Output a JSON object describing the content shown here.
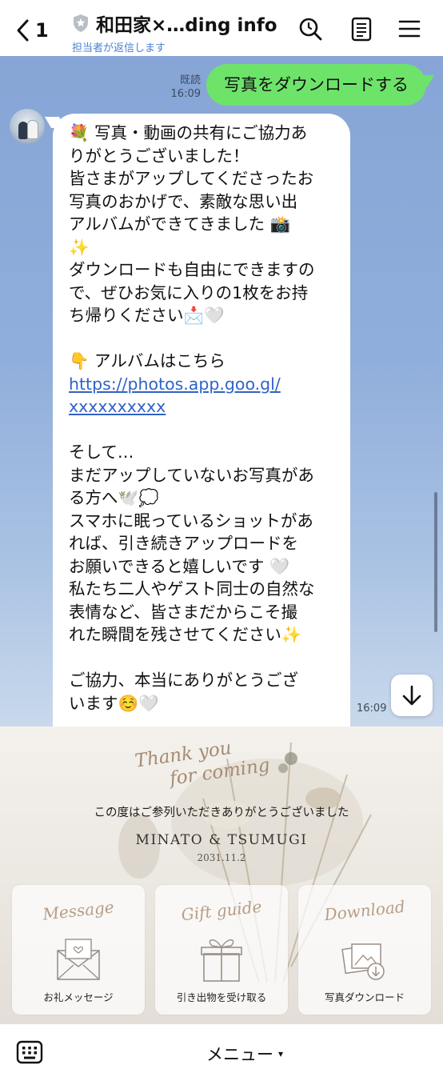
{
  "header": {
    "unread_count": "1",
    "title": "和田家×…ding info",
    "subtitle": "担当者が返信します",
    "icons": [
      "back-chevron-icon",
      "shield-icon",
      "search-icon",
      "notes-icon",
      "menu-icon"
    ]
  },
  "chat": {
    "sent": {
      "read_label": "既読",
      "time": "16:09",
      "text": "写真をダウンロードする"
    },
    "received": {
      "time": "16:09",
      "lines": [
        "💐 写真・動画の共有にご協力あ",
        "りがとうございました！",
        "皆さまがアップしてくださったお",
        "写真のおかげで、素敵な思い出",
        "アルバムができてきました 📸",
        "✨",
        "ダウンロードも自由にできますの",
        "で、ぜひお気に入りの1枚をお持",
        "ち帰りください📩🤍",
        "",
        "👇 アルバムはこちら",
        "https://photos.app.goo.gl/",
        "xxxxxxxxxx",
        "",
        "そして…",
        "まだアップしていないお写真があ",
        "る方へ🕊️💭",
        "スマホに眠っているショットがあ",
        "れば、引き続きアップロードを",
        "お願いできると嬉しいです 🤍",
        "私たち二人やゲスト同士の自然な",
        "表情など、皆さまだからこそ撮",
        "れた瞬間を残させてください✨",
        "",
        "ご協力、本当にありがとうござ",
        "います☺️🤍"
      ]
    }
  },
  "rich_menu": {
    "script_line1": "Thank you",
    "script_line2": "for coming",
    "message": "この度はご参列いただきありがとうございました",
    "couple": "MINATO & TSUMUGI",
    "date": "2031.11.2",
    "buttons": [
      {
        "script": "Message",
        "label": "お礼メッセージ",
        "icon": "envelope-icon"
      },
      {
        "script": "Gift guide",
        "label": "引き出物を受け取る",
        "icon": "gift-box-icon"
      },
      {
        "script": "Download",
        "label": "写真ダウンロード",
        "icon": "photo-download-icon"
      }
    ]
  },
  "bottom_bar": {
    "menu_label": "メニュー",
    "caret": "▾"
  },
  "colors": {
    "sent_bubble": "#6de36a",
    "chat_bg": "#8fabd9",
    "link": "#2f63c7",
    "subtitle": "#4a7fd1"
  }
}
